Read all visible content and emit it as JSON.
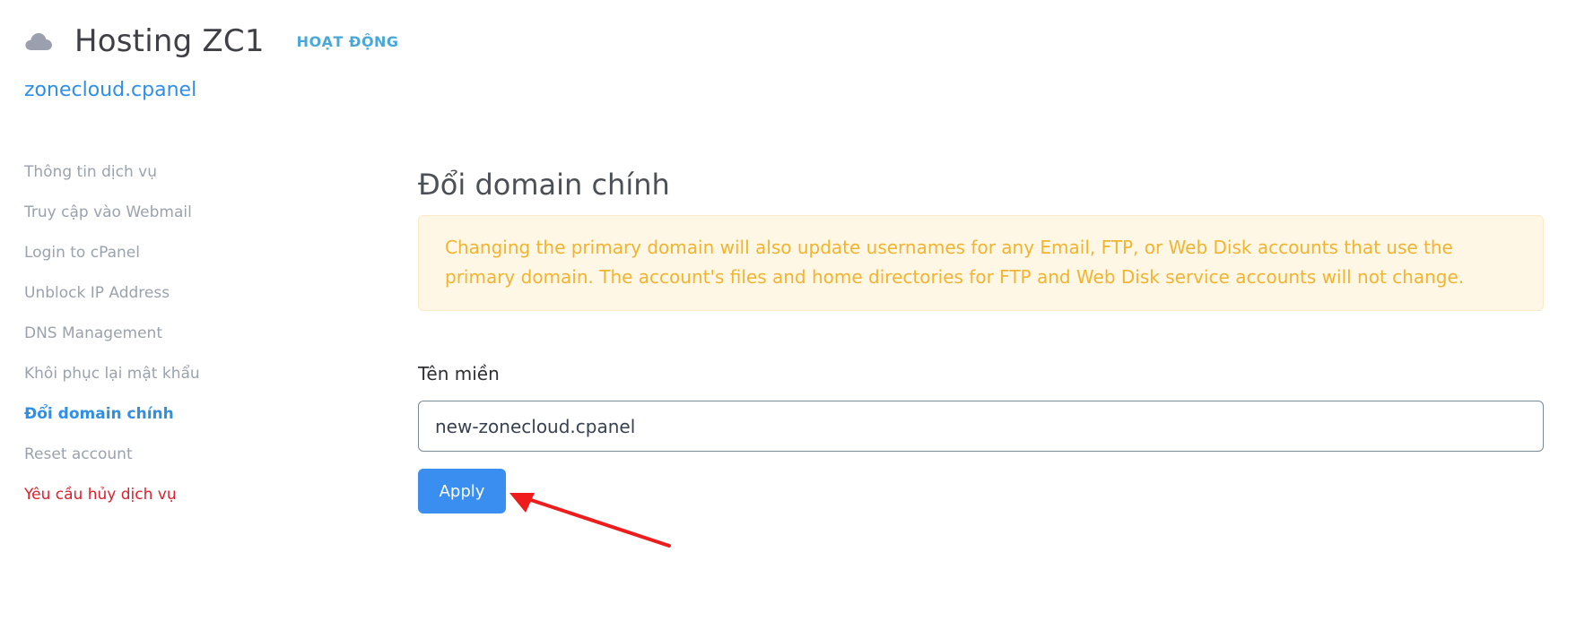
{
  "header": {
    "title": "Hosting ZC1",
    "status": "HOẠT ĐỘNG",
    "icon": "cloud-icon"
  },
  "account": {
    "domain": "zonecloud.cpanel"
  },
  "sidebar": {
    "items": [
      {
        "label": "Thông tin dịch vụ"
      },
      {
        "label": "Truy cập vào Webmail"
      },
      {
        "label": "Login to cPanel"
      },
      {
        "label": "Unblock IP Address"
      },
      {
        "label": "DNS Management"
      },
      {
        "label": "Khôi phục lại mật khẩu"
      },
      {
        "label": "Đổi domain chính",
        "active": true
      },
      {
        "label": "Reset account"
      },
      {
        "label": "Yêu cầu hủy dịch vụ",
        "danger": true
      }
    ]
  },
  "main": {
    "title": "Đổi domain chính",
    "alert": "Changing the primary domain will also update usernames for any Email, FTP, or Web Disk accounts that use the primary domain. The account's files and home directories for FTP and Web Disk service accounts will not change.",
    "field_label": "Tên miền",
    "field_value": "new-zonecloud.cpanel",
    "apply_label": "Apply"
  },
  "colors": {
    "accent": "#3a8ef0",
    "link": "#2f8fe8",
    "status": "#4aa8d8",
    "warning_text": "#f2b32f",
    "warning_bg": "#fff7e6",
    "danger": "#e11d2a",
    "annotation_arrow": "#ee1c1c"
  }
}
